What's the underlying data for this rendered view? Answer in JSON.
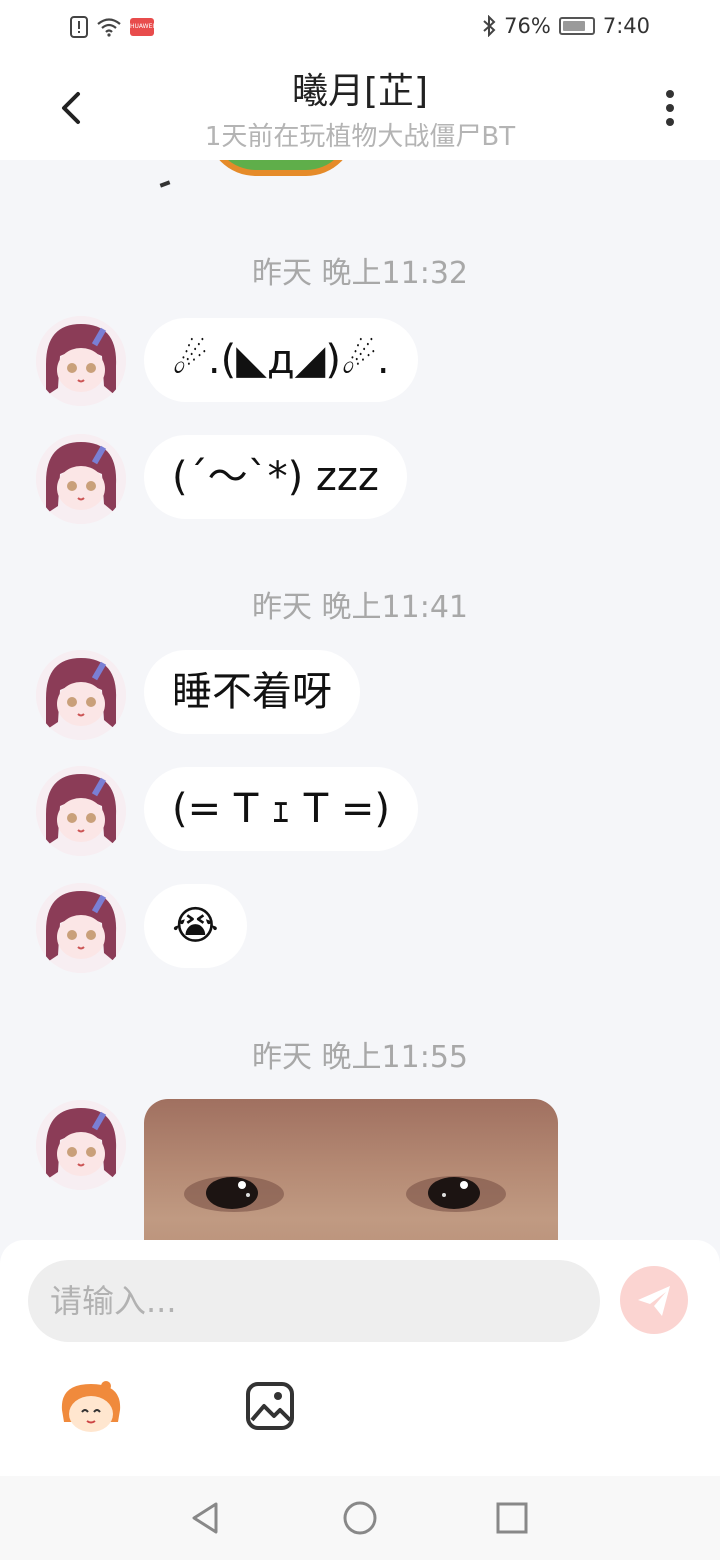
{
  "status_bar": {
    "battery": "76%",
    "time": "7:40",
    "app_badge": "HUAWEI",
    "icons": [
      "alert-icon",
      "wifi-icon",
      "bluetooth-icon",
      "battery-icon"
    ]
  },
  "header": {
    "title": "曦月[芷]",
    "subtitle": "1天前在玩植物大战僵尸BT"
  },
  "messages": [
    {
      "time": "昨天 晚上11:32"
    },
    {
      "text": "☄.(◣д◢)☄."
    },
    {
      "text": "(´～`*) zzz"
    },
    {
      "time": "昨天 晚上11:41"
    },
    {
      "text": "睡不着呀"
    },
    {
      "text": "(= T ｪ T =)"
    },
    {
      "text": "😭"
    },
    {
      "time": "昨天 晚上11:55"
    }
  ],
  "input": {
    "placeholder": "请输入..."
  },
  "colors": {
    "background": "#f5f6f9",
    "send_button": "#fbd4d1",
    "time_text": "#a8a8a8"
  }
}
